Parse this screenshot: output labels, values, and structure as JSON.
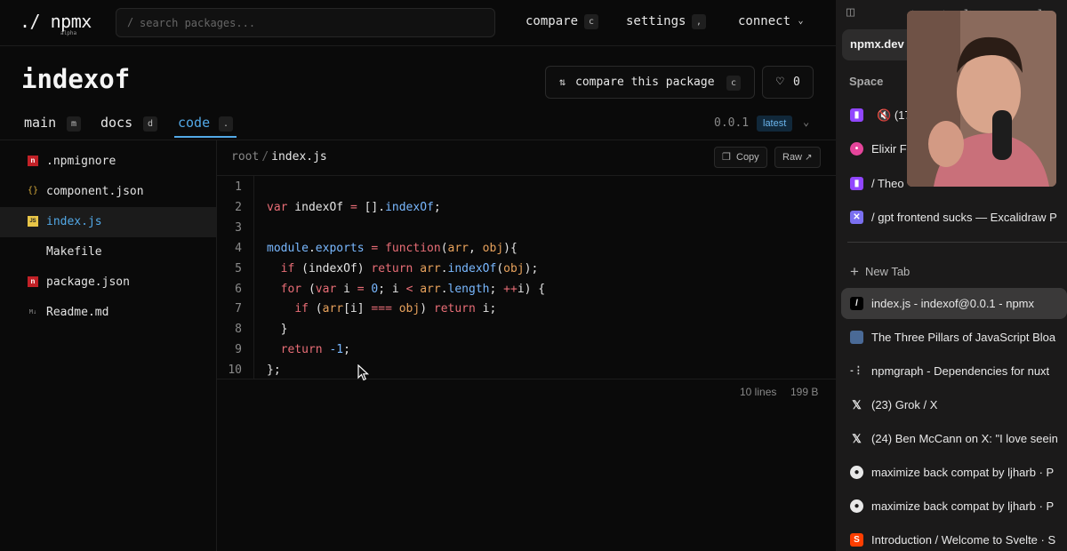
{
  "app": {
    "logo": "./ npmx",
    "logo_sub": "alpha",
    "search": {
      "prefix": "/",
      "placeholder": "search packages..."
    },
    "nav": {
      "compare_label": "compare",
      "compare_key": "c",
      "settings_label": "settings",
      "settings_key": ",",
      "connect_label": "connect"
    },
    "package": {
      "title": "indexof",
      "compare_btn_label": "compare this package",
      "compare_btn_key": "c",
      "like_count": "0",
      "version": "0.0.1",
      "dist_tag": "latest"
    },
    "tabs": [
      {
        "label": "main",
        "key": "m"
      },
      {
        "label": "docs",
        "key": "d"
      },
      {
        "label": "code",
        "key": "."
      }
    ],
    "files": [
      {
        "name": ".npmignore",
        "icon": "npm-file-icon"
      },
      {
        "name": "component.json",
        "icon": "json-file-icon"
      },
      {
        "name": "index.js",
        "icon": "js-file-icon"
      },
      {
        "name": "Makefile",
        "icon": "none"
      },
      {
        "name": "package.json",
        "icon": "npm-file-icon"
      },
      {
        "name": "Readme.md",
        "icon": "md-file-icon"
      }
    ],
    "viewer": {
      "root": "root",
      "file": "index.js",
      "copy_label": "Copy",
      "raw_label": "Raw",
      "lines_count": "10 lines",
      "size": "199 B"
    },
    "code_lines": [
      "",
      "var indexOf = [].indexOf;",
      "",
      "module.exports = function(arr, obj){",
      "  if (indexOf) return arr.indexOf(obj);",
      "  for (var i = 0; i < arr.length; ++i) {",
      "    if (arr[i] === obj) return i;",
      "  }",
      "  return -1;",
      "};"
    ],
    "colors": {
      "accent": "#52a8e6",
      "keyword": "#e86d76",
      "function": "#e8a25c"
    }
  },
  "browser_sidebar": {
    "url": "npmx.dev",
    "space_label": "Space",
    "pinned_tabs": [
      {
        "title": "(17",
        "icon": "twitch-icon"
      },
      {
        "title": "Elixir F",
        "icon": "chat-icon"
      },
      {
        "title": "/ Theo",
        "icon": "twitch-icon"
      },
      {
        "title": "/ gpt frontend sucks — Excalidraw P",
        "icon": "excalidraw-icon"
      }
    ],
    "new_tab_label": "New Tab",
    "tabs": [
      {
        "title": "index.js - indexof@0.0.1 - npmx",
        "icon": "npmx-icon"
      },
      {
        "title": "The Three Pillars of JavaScript Bloa",
        "icon": "blog-icon"
      },
      {
        "title": "npmgraph - Dependencies for nuxt",
        "icon": "npmgraph-icon"
      },
      {
        "title": "(23) Grok / X",
        "icon": "x-icon"
      },
      {
        "title": "(24) Ben McCann on X: \"I love seein",
        "icon": "x-icon"
      },
      {
        "title": "maximize back compat by ljharb · P",
        "icon": "github-icon"
      },
      {
        "title": "maximize back compat by ljharb · P",
        "icon": "github-icon"
      },
      {
        "title": "Introduction / Welcome to Svelte · S",
        "icon": "svelte-icon"
      }
    ]
  }
}
